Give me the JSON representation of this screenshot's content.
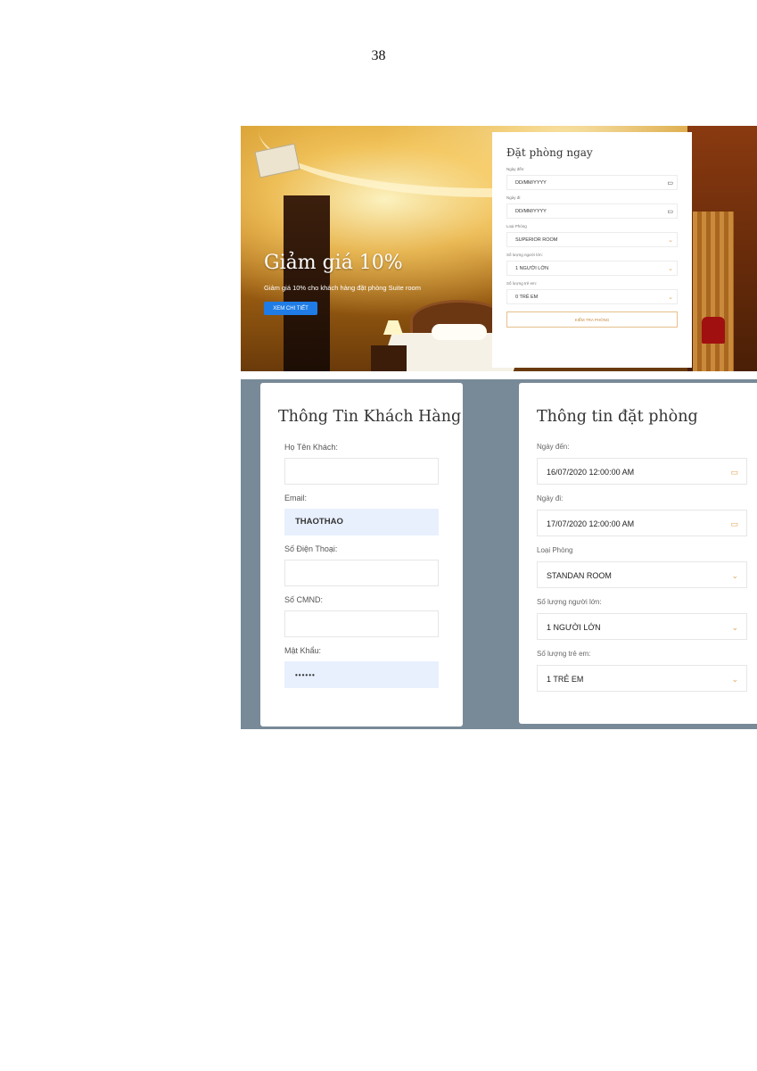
{
  "page_number": "38",
  "hero": {
    "title": "Giảm giá 10%",
    "subtitle": "Giảm giá 10% cho khách hàng đặt phòng Suite room",
    "button_label": "XEM CHI TIẾT"
  },
  "booking_widget": {
    "title": "Đặt phòng ngay",
    "checkin_label": "Ngày đến:",
    "checkin_value": "DD/MM/YYYY",
    "checkout_label": "Ngày đi:",
    "checkout_value": "DD/MM/YYYY",
    "room_type_label": "Loại Phòng",
    "room_type_value": "SUPERIOR ROOM",
    "adults_label": "Số lượng người lớn:",
    "adults_value": "1 NGƯỜI LỚN",
    "children_label": "Số lượng trẻ em:",
    "children_value": "0 TRẺ EM",
    "check_button": "KIỂM TRA PHÒNG",
    "icons": {
      "calendar": "calendar-icon",
      "dropdown": "chevron-down-icon"
    }
  },
  "customer_form": {
    "title": "Thông Tin Khách Hàng",
    "name_label": "Họ Tên Khách:",
    "name_value": "",
    "email_label": "Email:",
    "email_value": "THAOTHAO",
    "phone_label": "Số Điện Thoại:",
    "phone_value": "",
    "id_label": "Số CMND:",
    "id_value": "",
    "password_label": "Mật Khẩu:",
    "password_value": "••••••"
  },
  "booking_info": {
    "title": "Thông tin đặt phòng",
    "checkin_label": "Ngày đến:",
    "checkin_value": "16/07/2020 12:00:00 AM",
    "checkout_label": "Ngày đi:",
    "checkout_value": "17/07/2020 12:00:00 AM",
    "room_type_label": "Loại Phòng",
    "room_type_value": "STANDAN ROOM",
    "adults_label": "Số lượng người lớn:",
    "adults_value": "1 NGƯỜI LỚN",
    "children_label": "Số lượng trẻ em:",
    "children_value": "1 TRẺ EM"
  },
  "colors": {
    "primary_button": "#1f7ce6",
    "accent": "#e0a35a",
    "autofill": "#e8f0fe",
    "form_background": "#788a98"
  }
}
